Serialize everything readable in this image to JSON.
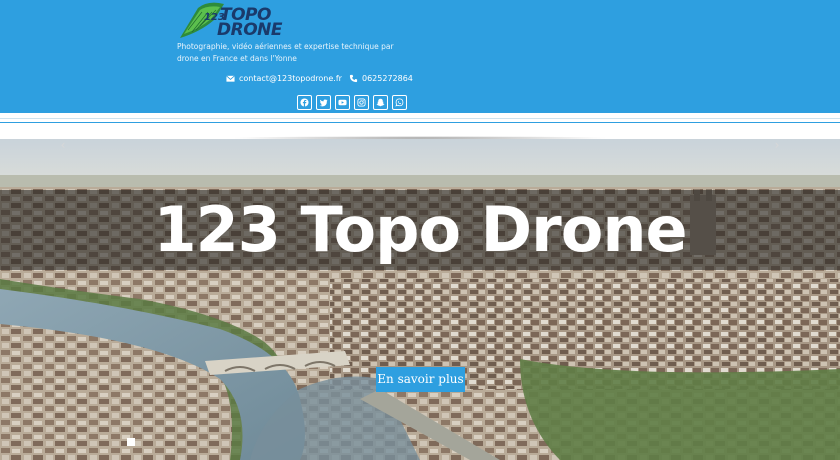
{
  "header": {
    "logo": {
      "num": "123",
      "line1": "TOPO",
      "line2": "DRONE"
    },
    "tagline": "Photographie, vidéo aériennes et expertise technique par drone en France et dans l'Yonne",
    "email": "contact@123topodrone.fr",
    "phone": "0625272864",
    "socials": [
      "facebook-icon",
      "twitter-icon",
      "youtube-icon",
      "instagram-icon",
      "snapchat-icon",
      "whatsapp-icon"
    ]
  },
  "hero": {
    "title": "123 Topo Drone",
    "cta_label": "En savoir plus",
    "prev_arrow": "‹",
    "next_arrow": "›"
  },
  "colors": {
    "brand_blue": "#2e9fe0",
    "logo_navy": "#1a3a6b",
    "logo_green": "#2e8b3c"
  }
}
